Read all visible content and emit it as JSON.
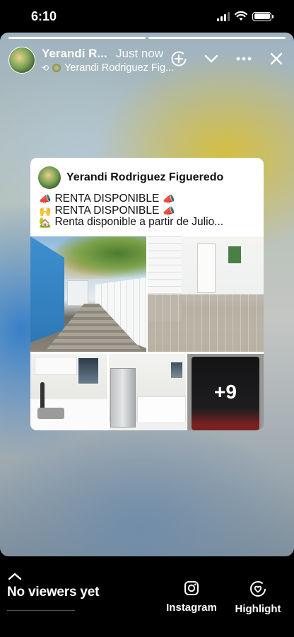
{
  "status_bar": {
    "time": "6:10"
  },
  "story": {
    "author_name": "Yerandi R...",
    "post_time": "Just now",
    "reshared_from": "Yerandi Rodriguez Fig...",
    "progress_segments": 2,
    "active_segment": 1
  },
  "post": {
    "author_name": "Yerandi Rodriguez Figueredo",
    "lines": [
      {
        "prefix_icon": "megaphone",
        "text": "RENTA DISPONIBLE",
        "suffix_icon": "megaphone"
      },
      {
        "prefix_icon": "hands",
        "text": "RENTA DISPONIBLE",
        "suffix_icon": "megaphone"
      },
      {
        "prefix_icon": "house",
        "text": "Renta disponible a partir de Julio...",
        "suffix_icon": ""
      }
    ],
    "more_photos_label": "+9"
  },
  "bottom": {
    "viewers_label": "No viewers yet",
    "instagram_label": "Instagram",
    "highlight_label": "Highlight"
  }
}
